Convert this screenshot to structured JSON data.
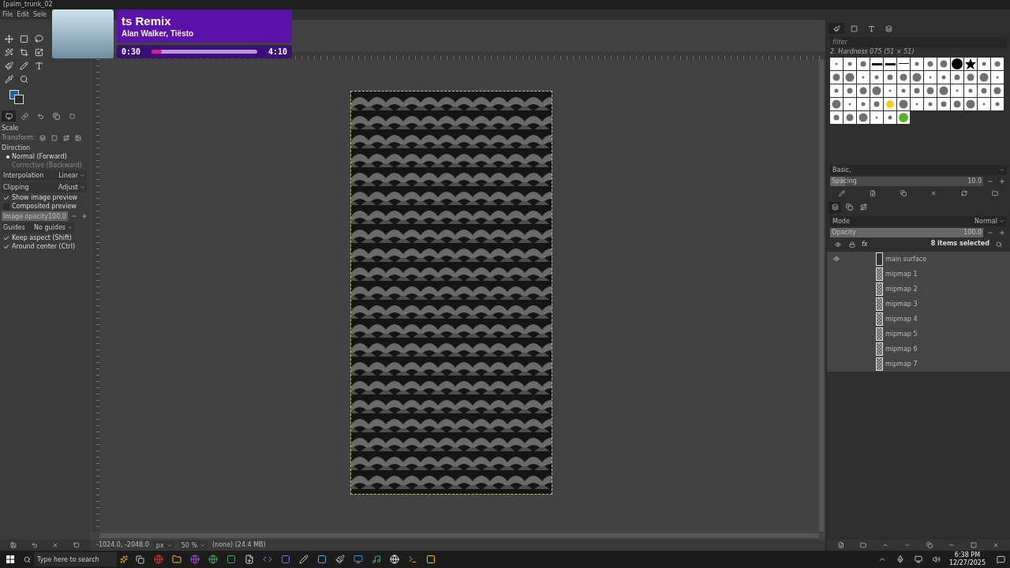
{
  "window": {
    "title": "[palm_trunk_02"
  },
  "menu": [
    "File",
    "Edit",
    "Sele"
  ],
  "media_player": {
    "title": "ts Remix",
    "artist": "Alan Walker, Tiësto",
    "elapsed": "0:30",
    "duration": "4:10",
    "progress": {
      "level": 0.1
    }
  },
  "tool_options": {
    "title": "Scale",
    "transform_label": "Transform:",
    "direction_label": "Direction",
    "directions": [
      {
        "label": "Normal (Forward)",
        "selected": true
      },
      {
        "label": "Corrective (Backward)",
        "selected": false
      }
    ],
    "dropdowns": [
      {
        "label": "Interpolation",
        "value": "Linear"
      },
      {
        "label": "Clipping",
        "value": "Adjust"
      }
    ],
    "preview_checks": [
      {
        "label": "Show image preview",
        "checked": true
      },
      {
        "label": "Composited preview",
        "checked": false
      }
    ],
    "opacity": {
      "label": "Image opacity",
      "value": "100.0",
      "level": 1
    },
    "guides": {
      "label": "Guides",
      "value": "No guides"
    },
    "constraint_checks": [
      {
        "label": "Keep aspect (Shift)",
        "checked": true
      },
      {
        "label": "Around center (Ctrl)",
        "checked": true
      }
    ]
  },
  "status_bar": {
    "coordinates": "-1024.0, -2048.0",
    "unit": "px",
    "zoom": "50 %",
    "info": "(none) (24.4 MB)"
  },
  "brushes": {
    "filter": {
      "placeholder": "filter"
    },
    "selected_brush": "2. Hardness 075 (51 × 51)",
    "tag": "Basic,",
    "spacing": {
      "label": "Spacing",
      "value": "10.0",
      "level": 0.1
    }
  },
  "layers": {
    "effects_label": "fx",
    "mode_label": "Mode",
    "mode": "Normal",
    "opacity": {
      "label": "Opacity",
      "value": "100.0",
      "level": 1
    },
    "selection_count": "8 items selected",
    "items": [
      {
        "name": "main surface",
        "visible": true,
        "selected": true
      },
      {
        "name": "mipmap 1",
        "visible": false,
        "selected": true
      },
      {
        "name": "mipmap 2",
        "visible": false,
        "selected": true
      },
      {
        "name": "mipmap 3",
        "visible": false,
        "selected": true
      },
      {
        "name": "mipmap 4",
        "visible": false,
        "selected": true
      },
      {
        "name": "mipmap 5",
        "visible": false,
        "selected": true
      },
      {
        "name": "mipmap 6",
        "visible": false,
        "selected": true
      },
      {
        "name": "mipmap 7",
        "visible": false,
        "selected": true
      }
    ]
  },
  "taskbar": {
    "search": {
      "placeholder": "Type here to search"
    },
    "time": "6:38 PM",
    "date": "12/27/2025"
  }
}
